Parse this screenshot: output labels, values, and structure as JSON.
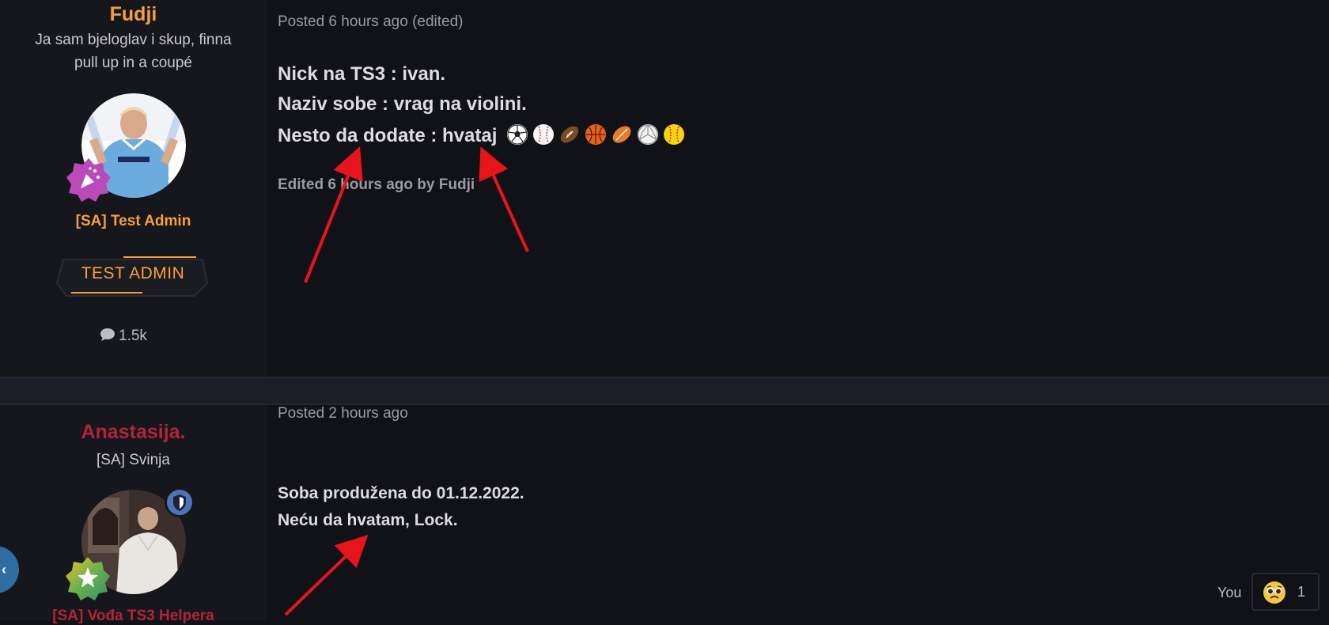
{
  "posts": [
    {
      "author": {
        "name": "Fudji",
        "tagline_1": "Ja sam bjeloglav i skup, finna",
        "tagline_2": "pull up in a coupé",
        "group": "[SA] Test Admin",
        "rank_badge": "TEST ADMIN",
        "post_count": "1.5k",
        "badge_icon": "party-popper-icon"
      },
      "meta": "Posted 6 hours ago (edited)",
      "lines": [
        "Nick na TS3 :  ivan.",
        "Naziv sobe : vrag na violini.",
        "Nesto da dodate : hvataj"
      ],
      "emojis": [
        "soccer-ball-icon",
        "baseball-icon",
        "american-football-icon",
        "basketball-icon",
        "rugby-ball-icon",
        "volleyball-icon",
        "softball-icon"
      ],
      "edited_note": "Edited 6 hours ago by Fudji"
    },
    {
      "author": {
        "name": "Anastasija.",
        "tagline_1": "[SA] Svinja",
        "group": "[SA] Vođa TS3 Helpera",
        "badge_icon": "star-icon",
        "secondary_badge_icon": "shield-icon"
      },
      "meta": "Posted 2 hours ago",
      "lines": [
        "Soba produžena do 01.12.2022.",
        "Neću da hvatam, Lock."
      ],
      "reaction": {
        "by": "You",
        "count": "1",
        "emoji": "pleading-face-icon"
      }
    }
  ],
  "colors": {
    "accent_orange": "#f5a03a",
    "name_red": "#b3233a",
    "annotation_arrow": "#e8141b",
    "background": "#111217",
    "author_panel": "#16171d"
  }
}
